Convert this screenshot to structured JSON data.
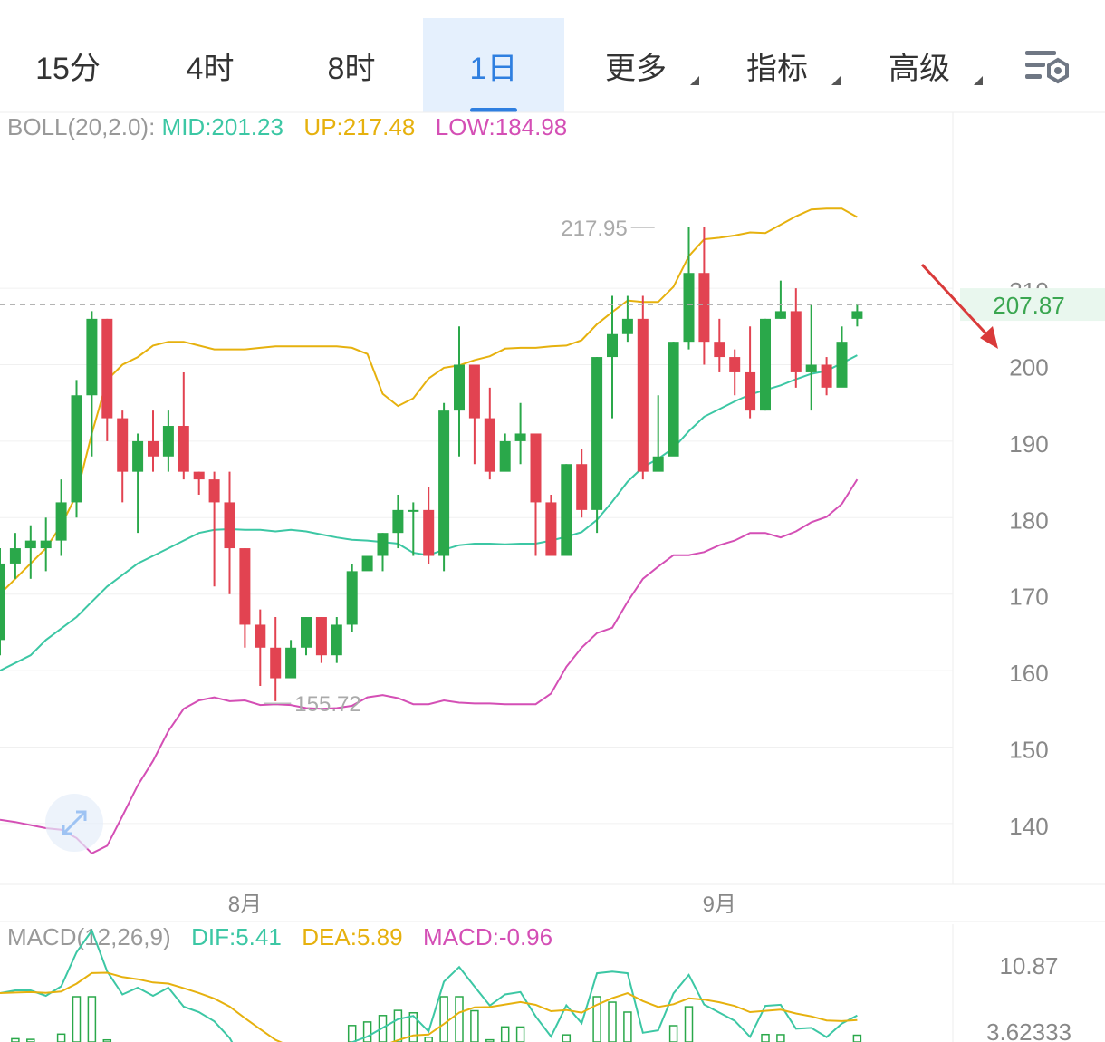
{
  "toolbar": {
    "tabs": [
      {
        "label": "15分",
        "active": false,
        "dropdown": false
      },
      {
        "label": "4时",
        "active": false,
        "dropdown": false
      },
      {
        "label": "8时",
        "active": false,
        "dropdown": false
      },
      {
        "label": "1日",
        "active": true,
        "dropdown": false
      },
      {
        "label": "更多",
        "active": false,
        "dropdown": true
      },
      {
        "label": "指标",
        "active": false,
        "dropdown": true
      },
      {
        "label": "高级",
        "active": false,
        "dropdown": true
      }
    ],
    "settings_icon": "chart-settings-icon"
  },
  "boll": {
    "name": "BOLL(20,2.0):",
    "mid": "MID:201.23",
    "up": "UP:217.48",
    "low": "LOW:184.98"
  },
  "macd": {
    "name": "MACD(12,26,9)",
    "dif": "DIF:5.41",
    "dea": "DEA:5.89",
    "macd": "MACD:-0.96"
  },
  "colors": {
    "up_candle": "#2aa84a",
    "down_candle": "#e24351",
    "mid_line": "#3cc7a4",
    "upper_band": "#e6b10e",
    "lower_band": "#d44fb5",
    "dif_line": "#3cc7a4",
    "dea_line": "#e6b10e",
    "active_tab": "#2f7fe0",
    "price_label": "#3aa650",
    "annotation_arrow": "#d93a3a"
  },
  "chart_data": {
    "type": "candlestick",
    "y_ticks": [
      140,
      150,
      160,
      170,
      180,
      190,
      200,
      210
    ],
    "ylim": [
      132,
      225
    ],
    "x_labels": [
      {
        "label": "8月",
        "index": 16
      },
      {
        "label": "9月",
        "index": 47
      }
    ],
    "current_price": "207.87",
    "max_marker": {
      "label": "217.95",
      "index": 43,
      "value": 217.95
    },
    "min_marker": {
      "label": "155.72",
      "index": 17,
      "value": 155.72
    },
    "candles": [
      [
        164,
        174,
        162,
        176
      ],
      [
        174,
        176,
        172,
        178
      ],
      [
        176,
        177,
        172,
        179
      ],
      [
        176,
        177,
        173,
        180
      ],
      [
        177,
        182,
        175,
        185
      ],
      [
        182,
        196,
        180,
        198
      ],
      [
        196,
        206,
        188,
        207
      ],
      [
        206,
        193,
        190,
        206
      ],
      [
        193,
        186,
        182,
        194
      ],
      [
        186,
        190,
        178,
        191
      ],
      [
        190,
        188,
        186,
        194
      ],
      [
        188,
        192,
        186,
        194
      ],
      [
        192,
        186,
        185,
        199
      ],
      [
        186,
        185,
        183,
        186
      ],
      [
        185,
        182,
        171,
        186
      ],
      [
        182,
        176,
        170,
        186
      ],
      [
        176,
        166,
        163,
        176
      ],
      [
        166,
        163,
        158,
        168
      ],
      [
        163,
        159,
        156,
        167
      ],
      [
        159,
        163,
        160,
        164
      ],
      [
        163,
        167,
        162,
        167
      ],
      [
        167,
        162,
        161,
        167
      ],
      [
        162,
        166,
        161,
        167
      ],
      [
        166,
        173,
        165,
        174
      ],
      [
        173,
        175,
        174,
        175
      ],
      [
        175,
        178,
        173,
        178
      ],
      [
        178,
        181,
        176,
        183
      ],
      [
        181,
        181,
        175,
        182
      ],
      [
        181,
        175,
        174,
        184
      ],
      [
        175,
        194,
        173,
        195
      ],
      [
        194,
        200,
        188,
        205
      ],
      [
        200,
        193,
        187,
        200
      ],
      [
        193,
        186,
        185,
        197
      ],
      [
        186,
        190,
        187,
        191
      ],
      [
        190,
        191,
        187,
        195
      ],
      [
        191,
        182,
        175,
        191
      ],
      [
        182,
        175,
        175,
        183
      ],
      [
        175,
        187,
        175,
        187
      ],
      [
        187,
        181,
        180,
        189
      ],
      [
        181,
        201,
        178,
        201
      ],
      [
        201,
        204,
        193,
        209
      ],
      [
        204,
        206,
        203,
        209
      ],
      [
        206,
        186,
        185,
        209
      ],
      [
        186,
        188,
        187,
        196
      ],
      [
        188,
        203,
        195,
        203
      ],
      [
        203,
        212,
        202,
        218
      ],
      [
        212,
        203,
        200,
        218
      ],
      [
        203,
        201,
        199,
        206
      ],
      [
        201,
        199,
        196,
        202
      ],
      [
        199,
        194,
        193,
        205
      ],
      [
        194,
        206,
        194,
        206
      ],
      [
        206,
        207,
        206,
        211
      ],
      [
        207,
        199,
        197,
        210
      ],
      [
        199,
        200,
        194,
        208
      ],
      [
        200,
        197,
        196,
        201
      ],
      [
        197,
        203,
        200,
        205
      ],
      [
        206,
        207,
        205,
        208
      ]
    ],
    "series": [
      {
        "name": "MID",
        "values": [
          160,
          161,
          162,
          164,
          165.5,
          167,
          169,
          171,
          172.5,
          174,
          175,
          176,
          177,
          178,
          178.4,
          178.5,
          178.4,
          178.4,
          178.2,
          178.4,
          178.2,
          177.8,
          177.4,
          177.1,
          177,
          176.8,
          176.6,
          175.4,
          175.1,
          175.8,
          176.4,
          176.6,
          176.6,
          176.5,
          176.6,
          176.6,
          177,
          177.5,
          178.1,
          179.7,
          182.1,
          184.7,
          186.6,
          187.7,
          189.1,
          191.3,
          193.2,
          194.2,
          195.2,
          196.1,
          196.7,
          197.3,
          198.1,
          198.8,
          199.2,
          200.2,
          201.23
        ]
      },
      {
        "name": "UP",
        "values": [
          170,
          172,
          174,
          176,
          179,
          183,
          191,
          198,
          200,
          201,
          202.5,
          203,
          203,
          202.5,
          202,
          202,
          202,
          202.2,
          202.4,
          202.4,
          202.4,
          202.4,
          202.4,
          202.2,
          201.4,
          196.2,
          194.6,
          195.6,
          198.2,
          199.6,
          199.9,
          200.6,
          201.1,
          202.1,
          202.2,
          202.2,
          202.4,
          202.5,
          203.2,
          205.3,
          206.9,
          208.4,
          208.2,
          208.2,
          210.2,
          214.2,
          216.4,
          216.6,
          216.9,
          217.3,
          217.2,
          218.3,
          219.4,
          220.3,
          220.4,
          220.4,
          219.3
        ]
      },
      {
        "name": "LOW",
        "values": [
          140.5,
          140.2,
          139.8,
          139.4,
          139.2,
          138.1,
          136.1,
          137.1,
          141,
          145,
          148.2,
          152.1,
          155,
          156.1,
          156.5,
          156,
          156.1,
          155.5,
          155.6,
          155.5,
          155.1,
          155,
          155.1,
          155.4,
          156.5,
          156.8,
          156.4,
          155.6,
          155.6,
          156.1,
          155.8,
          155.7,
          155.7,
          155.6,
          155.6,
          155.6,
          157,
          160.5,
          163,
          164.9,
          165.6,
          169,
          172,
          173.6,
          175.1,
          175.1,
          175.5,
          176.4,
          177,
          178,
          178,
          177.4,
          178.2,
          179.4,
          180.1,
          181.8,
          185
        ]
      }
    ],
    "macd_axis": {
      "ticks": [
        "10.87",
        "3.62333"
      ]
    }
  }
}
